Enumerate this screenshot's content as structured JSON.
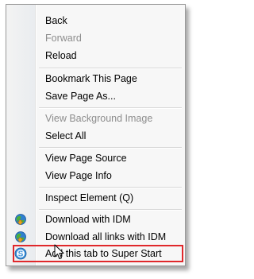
{
  "context_menu": {
    "items": [
      {
        "label": "Back",
        "disabled": false
      },
      {
        "label": "Forward",
        "disabled": true
      },
      {
        "label": "Reload",
        "disabled": false
      },
      {
        "label": "Bookmark This Page",
        "disabled": false
      },
      {
        "label": "Save Page As...",
        "disabled": false
      },
      {
        "label": "View Background Image",
        "disabled": true
      },
      {
        "label": "Select All",
        "disabled": false
      },
      {
        "label": "View Page Source",
        "disabled": false
      },
      {
        "label": "View Page Info",
        "disabled": false
      },
      {
        "label": "Inspect Element (Q)",
        "disabled": false
      },
      {
        "label": "Download with IDM",
        "disabled": false,
        "icon": "idm-globe-icon"
      },
      {
        "label": "Download all links with IDM",
        "disabled": false,
        "icon": "idm-globe-icon"
      },
      {
        "label": "Add this tab to Super Start",
        "disabled": false,
        "icon": "super-start-icon",
        "highlighted": true
      }
    ]
  },
  "colors": {
    "highlight_border": "#e0282b",
    "disabled_text": "#8d8d8d",
    "super_start_blue": "#3a8fd9"
  }
}
